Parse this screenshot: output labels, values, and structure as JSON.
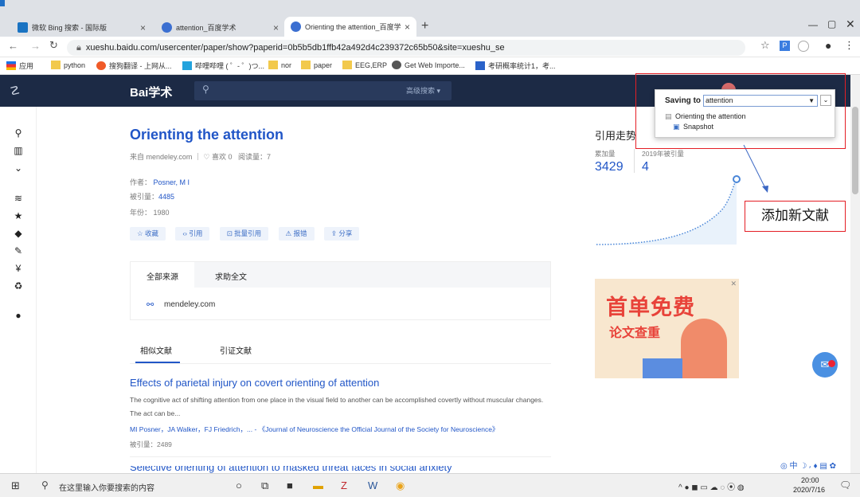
{
  "browser": {
    "tabs": [
      {
        "title": "微软 Bing 搜索 - 国际版"
      },
      {
        "title": "attention_百度学术"
      },
      {
        "title": "Orienting the attention_百度学"
      }
    ],
    "new_tab": "+",
    "url": "xueshu.baidu.com/usercenter/paper/show?paperid=0b5b5db1ffb42a492d4c239372c65b50&site=xueshu_se",
    "bookmarks": [
      "应用",
      "python",
      "搜狗翻译 - 上网从...",
      "哔哩哔哩 ( ゜- ゜)つ...",
      "nor",
      "paper",
      "EEG,ERP",
      "Get Web Importe...",
      "考研概率统计1，考..."
    ]
  },
  "site": {
    "logo": "Bai学术",
    "search_placeholder": "",
    "advanced": "高级搜索 ▾"
  },
  "paper": {
    "title": "Orienting the attention",
    "meta_source": "来自 mendeley.com",
    "meta_likes": "♡ 喜欢 0",
    "meta_reads": "阅读量：7",
    "author_label": "作者：",
    "author": "Posner, M I",
    "cited_label": "被引量：",
    "cited": "4485",
    "year_label": "年份：",
    "year": "1980",
    "actions": [
      "☆ 收藏",
      "‹› 引用",
      "⊡ 批量引用",
      "⚠ 报错",
      "⇪ 分享"
    ],
    "source_tabs": [
      "全部来源",
      "求助全文"
    ],
    "source_link": "mendeley.com",
    "related_tabs": [
      "相似文献",
      "引证文献"
    ]
  },
  "related": [
    {
      "title": "Effects of parietal injury on covert orienting of attention",
      "abstract": "The cognitive act of shifting attention from one place in the visual field to another can be accomplished covertly without muscular changes. The act can be...",
      "authors": "MI Posner，JA Walker，FJ Friedrich，... - 《Journal of Neuroscience the Official Journal of the Society for Neuroscience》",
      "cited": "被引量：2489"
    },
    {
      "title": "Selective orienting of attention to masked threat faces in social anxiety"
    }
  ],
  "trend": {
    "heading": "引用走势",
    "total_label": "累加量",
    "total": "3429",
    "year_label": "2019年被引量",
    "year_value": "4"
  },
  "ad": {
    "line1": "首单免费",
    "line2": "论文查重"
  },
  "zotero": {
    "saving_to_label": "Saving to",
    "collection": "attention",
    "item": "Orienting the attention",
    "snapshot": "Snapshot"
  },
  "annotation": "添加新文献",
  "taskbar": {
    "search_placeholder": "在这里输入你要搜索的内容",
    "time": "20:00",
    "date": "2020/7/16"
  },
  "colors": {
    "header": "#1c2a45",
    "link": "#2156c7",
    "accent": "#e41e25"
  }
}
